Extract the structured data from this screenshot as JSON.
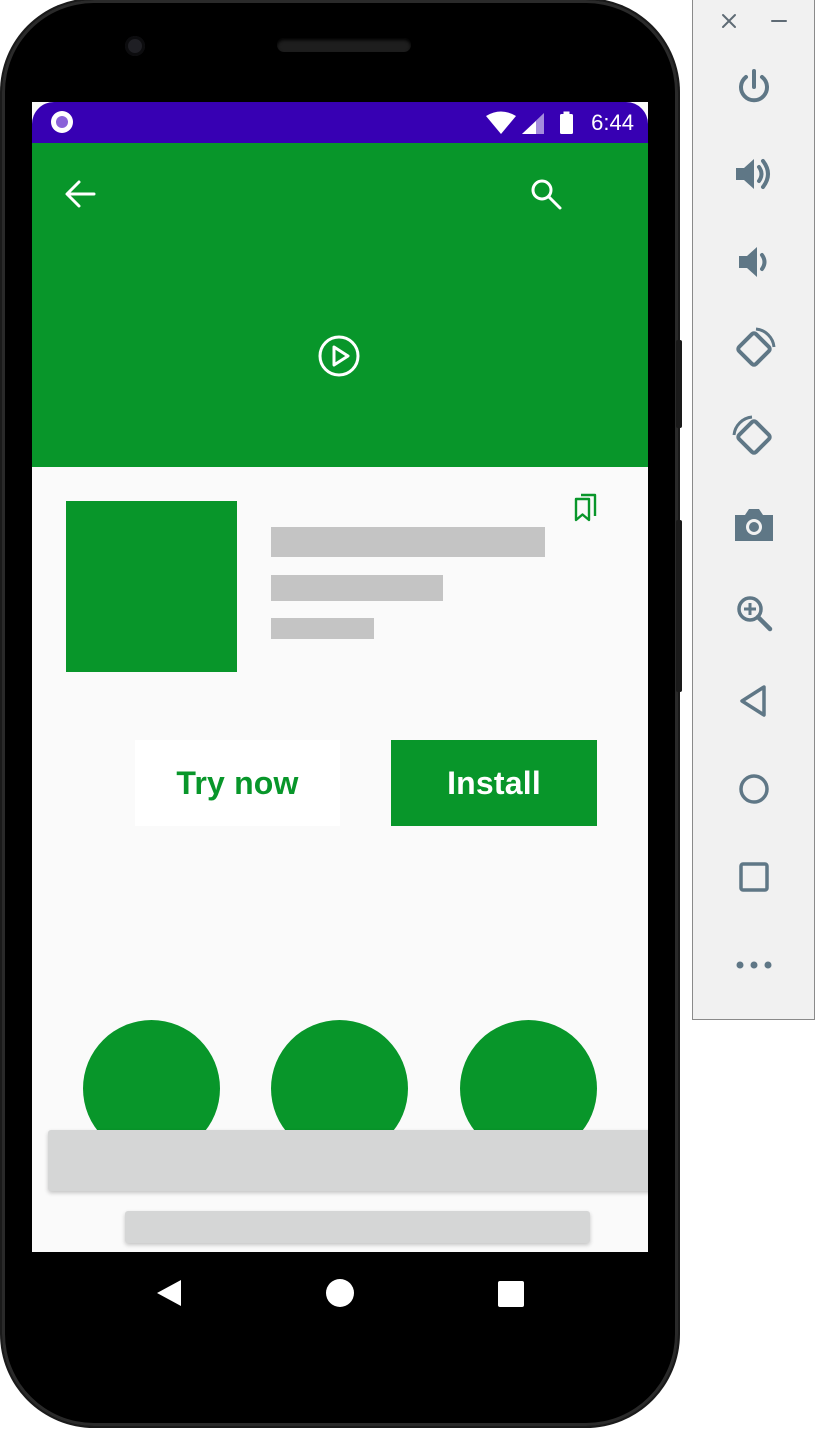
{
  "status_bar": {
    "time": "6:44"
  },
  "app_detail": {
    "try_now_label": "Try now",
    "install_label": "Install"
  },
  "colors": {
    "primary": "#08962a",
    "status_bar": "#3700b3",
    "placeholder": "#c4c4c4",
    "background": "#fafafa",
    "toolbar_icon": "#5f7786"
  },
  "toolbar": {
    "icons": [
      "close-icon",
      "minimize-icon",
      "power-icon",
      "volume-up-icon",
      "volume-down-icon",
      "rotate-left-icon",
      "rotate-right-icon",
      "camera-icon",
      "zoom-icon",
      "back-icon",
      "home-icon",
      "overview-icon",
      "more-icon"
    ]
  }
}
